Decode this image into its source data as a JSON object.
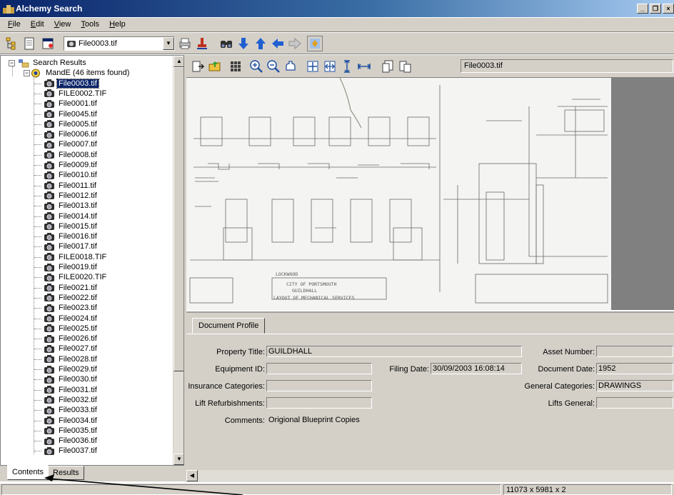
{
  "window": {
    "title": "Alchemy Search"
  },
  "menu": [
    "File",
    "Edit",
    "View",
    "Tools",
    "Help"
  ],
  "toolbar": {
    "current_file": "File0003.tif",
    "icons": [
      "tree-view-icon",
      "document-icon",
      "properties-icon",
      "print-icon",
      "stamp-icon",
      "find-icon",
      "arrow-down-icon",
      "arrow-up-icon",
      "arrow-left-icon",
      "arrow-right-icon",
      "refresh-icon"
    ]
  },
  "tree": {
    "root": "Search Results",
    "group": "MandE (46 items found)",
    "items": [
      "File0003.tif",
      "FILE0002.TIF",
      "File0001.tif",
      "File0045.tif",
      "File0005.tif",
      "File0006.tif",
      "File0007.tif",
      "File0008.tif",
      "File0009.tif",
      "File0010.tif",
      "File0011.tif",
      "File0012.tif",
      "File0013.tif",
      "File0014.tif",
      "File0015.tif",
      "File0016.tif",
      "File0017.tif",
      "FILE0018.TIF",
      "File0019.tif",
      "FILE0020.TIF",
      "File0021.tif",
      "File0022.tif",
      "File0023.tif",
      "File0024.tif",
      "File0025.tif",
      "File0026.tif",
      "File0027.tif",
      "File0028.tif",
      "File0029.tif",
      "File0030.tif",
      "File0031.tif",
      "File0032.tif",
      "File0033.tif",
      "File0034.tif",
      "File0035.tif",
      "File0036.tif",
      "File0037.tif"
    ],
    "selected_index": 0
  },
  "bottom_tabs": [
    "Contents",
    "Results"
  ],
  "viewer": {
    "doc_name": "File0003.tif",
    "drawing_text": [
      "LOCKWOOD",
      "CITY OF PORTSMOUTH",
      "GUILDHALL",
      "LAYOUT OF MECHANICAL SERVICES"
    ]
  },
  "profile": {
    "tab": "Document Profile",
    "fields": {
      "property_title": {
        "label": "Property Title:",
        "value": "GUILDHALL"
      },
      "asset_number": {
        "label": "Asset Number:",
        "value": ""
      },
      "equipment_id": {
        "label": "Equipment ID:",
        "value": ""
      },
      "filing_date": {
        "label": "Filing Date:",
        "value": "30/09/2003 16:08:14"
      },
      "document_date": {
        "label": "Document Date:",
        "value": "1952"
      },
      "insurance_categories": {
        "label": "Insurance Categories:",
        "value": ""
      },
      "general_categories": {
        "label": "General Categories:",
        "value": "DRAWINGS"
      },
      "lift_refurbishments": {
        "label": "Lift Refurbishments:",
        "value": ""
      },
      "lifts_general": {
        "label": "Lifts General:",
        "value": ""
      },
      "comments": {
        "label": "Comments:",
        "value": "Origional Blueprint Copies"
      }
    }
  },
  "status": {
    "dimensions": "11073 x 5981 x 2"
  }
}
